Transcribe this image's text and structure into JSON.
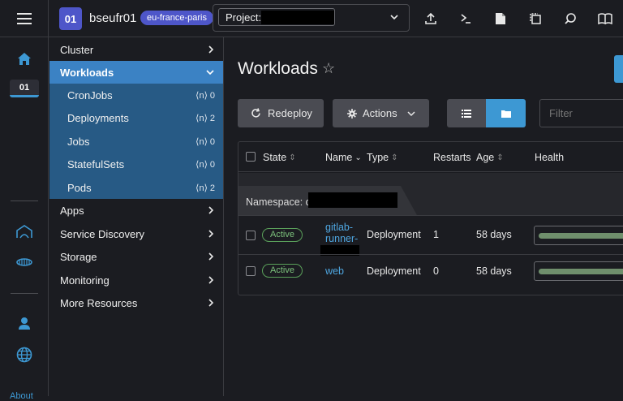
{
  "topbar": {
    "cluster_badge": "01",
    "cluster_name": "bseufr01",
    "region": "eu-france-paris",
    "project_label": "Project:",
    "icons": [
      "menu-icon",
      "upload-icon",
      "terminal-icon",
      "file-icon",
      "copy-icon",
      "search-icon",
      "book-icon"
    ]
  },
  "rail": {
    "cluster_label": "01",
    "about_label": "About"
  },
  "sidenav": {
    "items_top": [
      {
        "label": "Cluster"
      },
      {
        "label": "Workloads"
      }
    ],
    "sub_items": [
      {
        "label": "CronJobs",
        "count": "0"
      },
      {
        "label": "Deployments",
        "count": "2"
      },
      {
        "label": "Jobs",
        "count": "0"
      },
      {
        "label": "StatefulSets",
        "count": "0"
      },
      {
        "label": "Pods",
        "count": "2"
      }
    ],
    "items_bottom": [
      {
        "label": "Apps"
      },
      {
        "label": "Service Discovery"
      },
      {
        "label": "Storage"
      },
      {
        "label": "Monitoring"
      },
      {
        "label": "More Resources"
      }
    ]
  },
  "main": {
    "title": "Workloads",
    "redeploy_label": "Redeploy",
    "actions_label": "Actions",
    "filter_placeholder": "Filter",
    "columns": [
      "State",
      "Name",
      "Type",
      "Restarts",
      "Age",
      "Health"
    ],
    "namespace_label": "Namespace: c-",
    "rows": [
      {
        "state": "Active",
        "name_line1": "gitlab-",
        "name_line2": "runner-",
        "type": "Deployment",
        "restarts": "1",
        "age": "58 days",
        "health": 1.0
      },
      {
        "state": "Active",
        "name_line1": "web",
        "name_line2": "",
        "type": "Deployment",
        "restarts": "0",
        "age": "58 days",
        "health": 1.0
      }
    ]
  },
  "colors": {
    "accent": "#3d98d3",
    "active_nav": "#3b82c4",
    "nav_group_bg": "#275a85",
    "badge_purple": "#4e56c9",
    "active_state": "#7cc27c"
  }
}
